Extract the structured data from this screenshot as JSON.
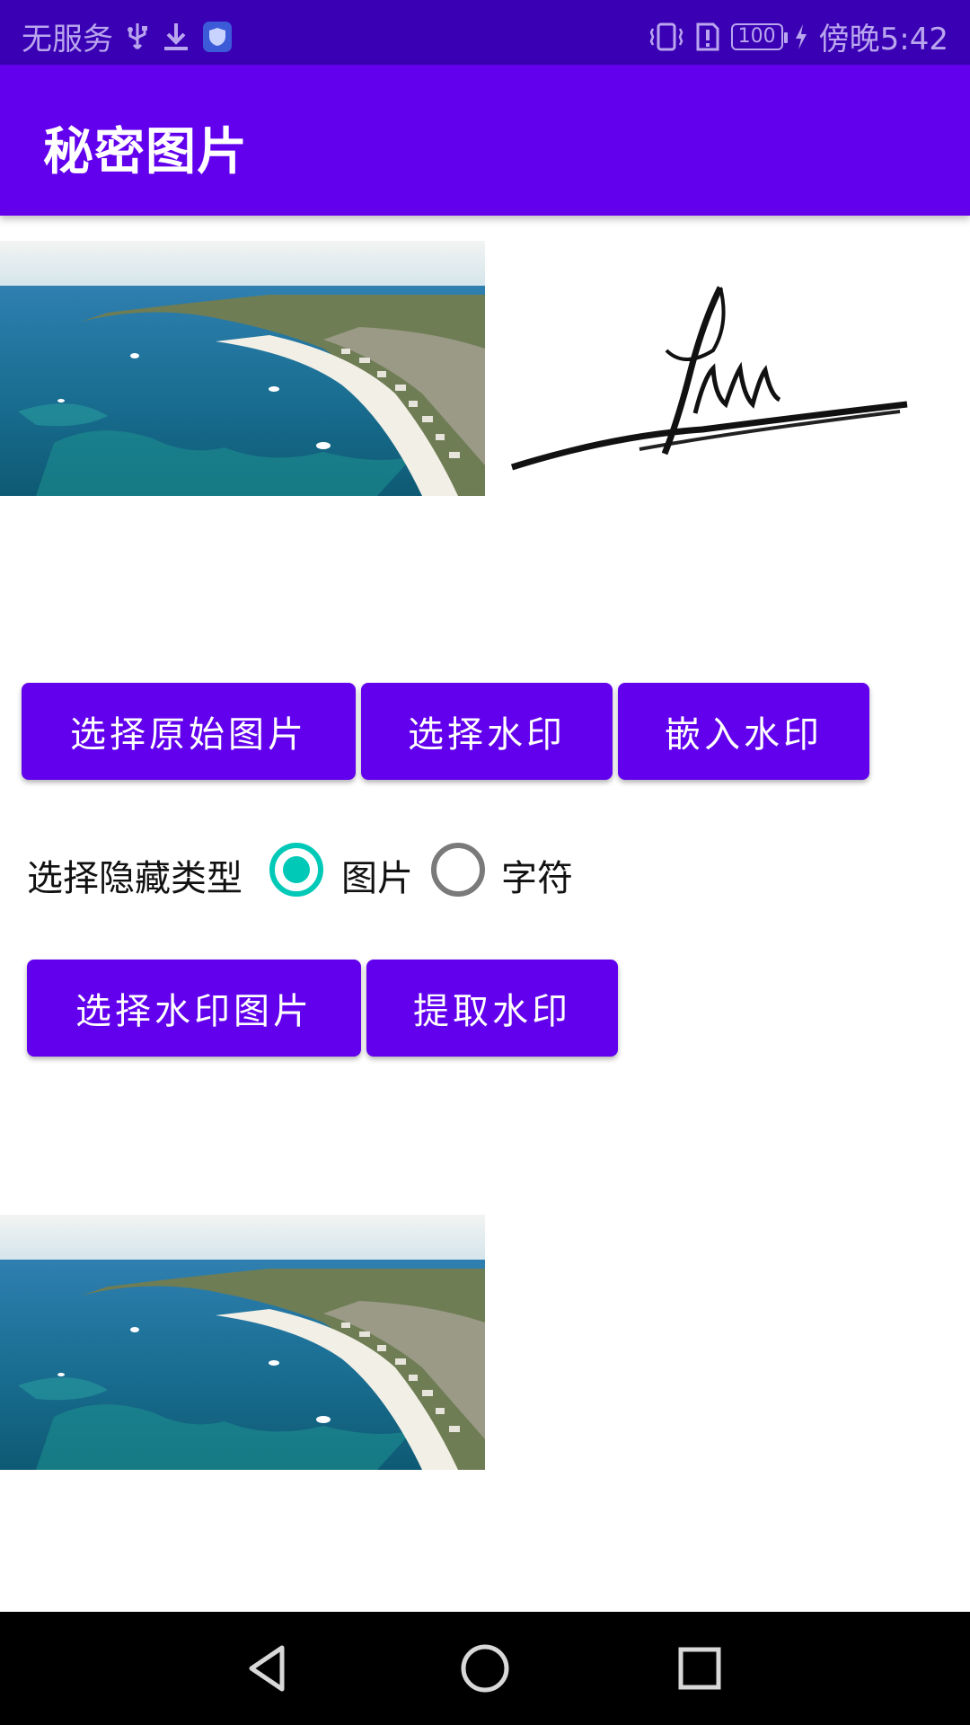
{
  "status_bar": {
    "carrier": "无服务",
    "battery": "100",
    "time": "傍晚5:42",
    "icons": [
      "usb-icon",
      "download-icon",
      "shield-icon",
      "vibrate-icon",
      "alert-icon",
      "battery-icon",
      "charging-icon"
    ]
  },
  "app_bar": {
    "title": "秘密图片"
  },
  "buttons": {
    "select_original": "选择原始图片",
    "select_watermark": "选择水印",
    "embed_watermark": "嵌入水印",
    "select_watermark_image": "选择水印图片",
    "extract_watermark": "提取水印"
  },
  "hide_type": {
    "label": "选择隐藏类型",
    "options": [
      {
        "label": "图片",
        "selected": true
      },
      {
        "label": "字符",
        "selected": false
      }
    ]
  },
  "colors": {
    "primary": "#6200ee",
    "primary_dark": "#3a00b3",
    "accent": "#00c9b7",
    "status_text": "#b9a6ee"
  },
  "nav_bar": {
    "icons": [
      "back-icon",
      "home-icon",
      "recents-icon"
    ]
  }
}
